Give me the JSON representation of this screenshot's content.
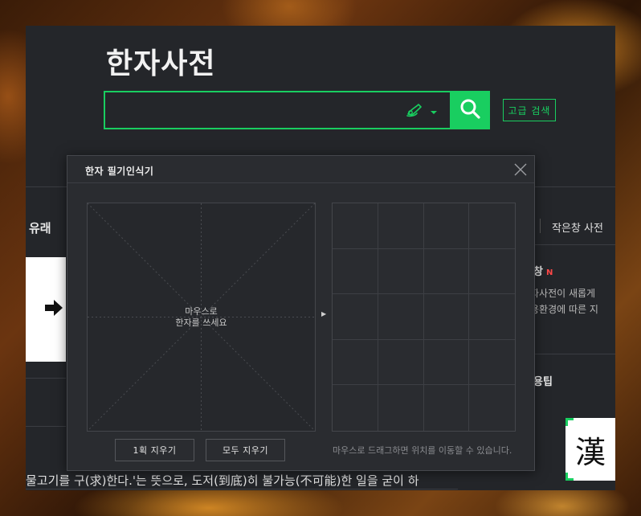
{
  "app": {
    "title": "한자사전",
    "search": {
      "value": "",
      "placeholder": ""
    },
    "advanced_search_label": "고급 검색"
  },
  "left": {
    "tab_label": "유래",
    "article_text": "물고기를 구(求)한다.'는 뜻으로, 도저(到底)히 불가능(不可能)한 일을 굳이 하"
  },
  "right": {
    "small_window_label": "작은창 사전",
    "notice_title": "창",
    "notice_new": "N",
    "notice_line1": "자사전이 새롭게",
    "notice_line2": "용환경에 따른 지",
    "tip_title": "용팁",
    "hanja_char": "漢"
  },
  "dialog": {
    "title": "한자 필기인식기",
    "draw_hint_line1": "마우스로",
    "draw_hint_line2": "한자를 쓰세요",
    "erase_one_label": "1획 지우기",
    "erase_all_label": "모두 지우기",
    "drag_hint": "마우스로 드래그하면 위치를 이동할 수 있습니다."
  },
  "colors": {
    "accent": "#19ce60",
    "panel": "#24262a",
    "dialog": "#2a2c30",
    "new_badge": "#ff4848"
  },
  "icons": {
    "search": "search-icon",
    "pen": "handwriting-pen-icon",
    "dropdown": "chevron-down-icon",
    "close": "close-icon",
    "arrow": "arrow-right-icon"
  }
}
